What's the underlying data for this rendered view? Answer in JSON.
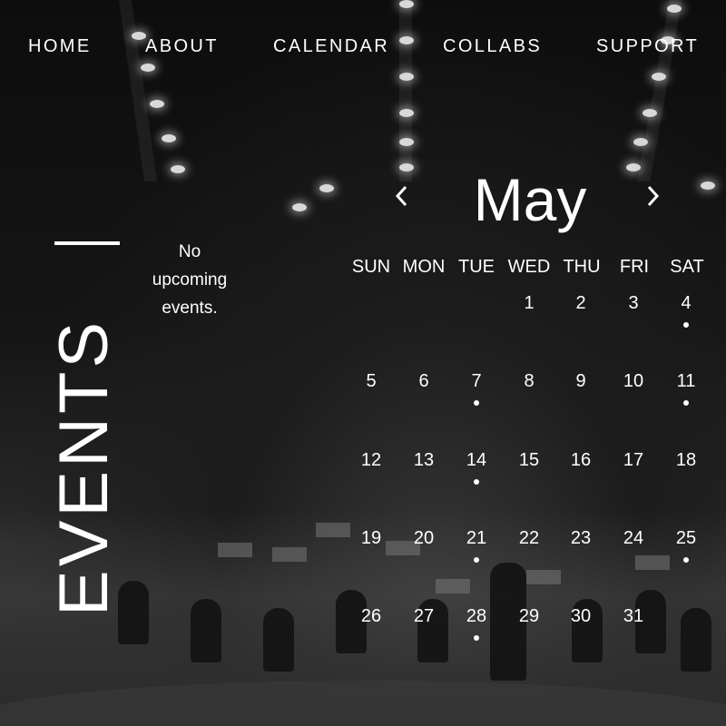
{
  "nav": {
    "items": [
      "HOME",
      "ABOUT",
      "CALENDAR",
      "COLLABS",
      "SUPPORT"
    ]
  },
  "events": {
    "title": "EVENTS",
    "empty_message": "No upcoming events."
  },
  "calendar": {
    "month": "May",
    "prev_icon": "chevron-left-icon",
    "next_icon": "chevron-right-icon",
    "weekdays": [
      "SUN",
      "MON",
      "TUE",
      "WED",
      "THU",
      "FRI",
      "SAT"
    ],
    "first_weekday_index": 3,
    "days_in_month": 31,
    "days_with_events": [
      4,
      7,
      11,
      14,
      21,
      25,
      28
    ]
  },
  "colors": {
    "text": "#ffffff",
    "background": "#0a0a0a"
  }
}
